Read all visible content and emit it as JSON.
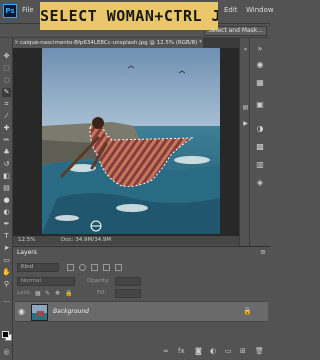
{
  "banner": {
    "text": "SELECT WOMAN+CTRL J"
  },
  "appbar": {
    "logo": "Ps",
    "menu": [
      "File",
      "Edit",
      "Window"
    ]
  },
  "options": {
    "select_mask_label": "Select and Mask..."
  },
  "document": {
    "tab_title": "caique-nascimento-Bfp634LE8Cc-unsplash.jpg @ 12.5% (RGB/8) *",
    "close_glyph": "×"
  },
  "status": {
    "zoom": "12.5%",
    "doc_size": "Doc: 34.9M/34.9M"
  },
  "layers_panel": {
    "tab_label": "Layers",
    "kind_label": "Kind",
    "blend_mode": "Normal",
    "opacity_label": "Opacity:",
    "lock_label": "Lock:",
    "fill_label": "Fill:",
    "layers": [
      {
        "name": "Background",
        "locked": true,
        "visible": true
      }
    ]
  },
  "colors": {
    "banner_bg": "#e9c76a",
    "ui_gray": "#535353",
    "canvas_bg": "#282828",
    "accent_blue": "#31a8ff"
  },
  "icons": {
    "tools": [
      "move-icon",
      "marquee-icon",
      "lasso-icon",
      "quick-select-icon",
      "crop-icon",
      "eyedropper-icon",
      "healing-icon",
      "brush-icon",
      "stamp-icon",
      "history-brush-icon",
      "eraser-icon",
      "gradient-icon",
      "blur-icon",
      "dodge-icon",
      "pen-icon",
      "type-icon",
      "path-select-icon",
      "shape-icon",
      "hand-icon",
      "zoom-icon"
    ],
    "right_panel": [
      "color-icon",
      "swatches-icon",
      "libraries-icon",
      "adjustments-icon",
      "styles-icon",
      "properties-icon",
      "channels-icon"
    ]
  }
}
